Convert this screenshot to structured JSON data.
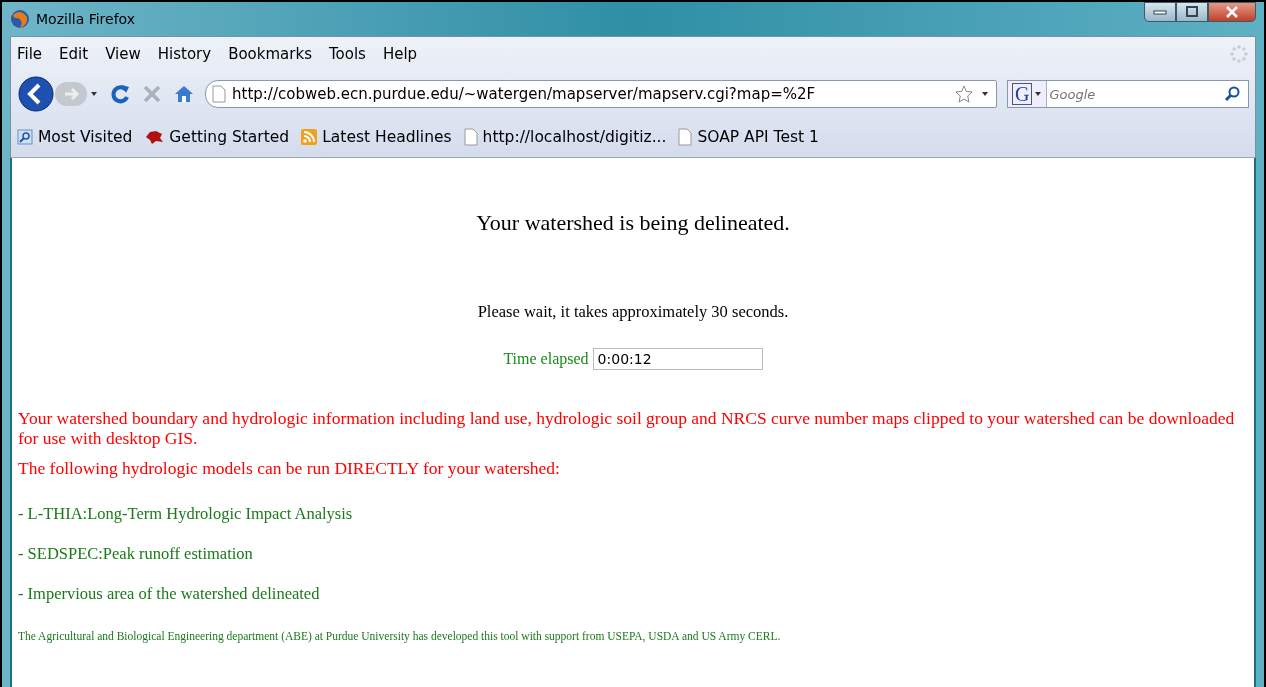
{
  "window": {
    "title": "Mozilla Firefox"
  },
  "menu": [
    "File",
    "Edit",
    "View",
    "History",
    "Bookmarks",
    "Tools",
    "Help"
  ],
  "address_bar": {
    "value": "http://cobweb.ecn.purdue.edu/~watergen/mapserver/mapserv.cgi?map=%2F"
  },
  "search": {
    "engine": "G",
    "placeholder": "Google"
  },
  "bookmarks": [
    {
      "kind": "search",
      "label": "Most Visited"
    },
    {
      "kind": "animal",
      "label": "Getting Started"
    },
    {
      "kind": "rss",
      "label": "Latest Headlines"
    },
    {
      "kind": "page",
      "label": "http://localhost/digitiz..."
    },
    {
      "kind": "page",
      "label": "SOAP API Test 1"
    }
  ],
  "page": {
    "heading": "Your watershed is being delineated.",
    "wait_text": "Please wait, it takes approximately 30 seconds.",
    "timer": {
      "label": "Time elapsed",
      "value": "0:00:12"
    },
    "notices": [
      "Your watershed boundary and hydrologic information including land use, hydrologic soil group and NRCS curve number maps clipped to your watershed can be downloaded for use with desktop GIS.",
      "The following hydrologic models can be run DIRECTLY for your watershed:"
    ],
    "models": [
      "- L-THIA:Long-Term Hydrologic Impact Analysis",
      "- SEDSPEC:Peak runoff estimation",
      "- Impervious area of the watershed delineated"
    ],
    "footer": "The Agricultural and Biological Engineering department (ABE) at Purdue University has developed this tool with support from USEPA, USDA and US Army CERL."
  }
}
